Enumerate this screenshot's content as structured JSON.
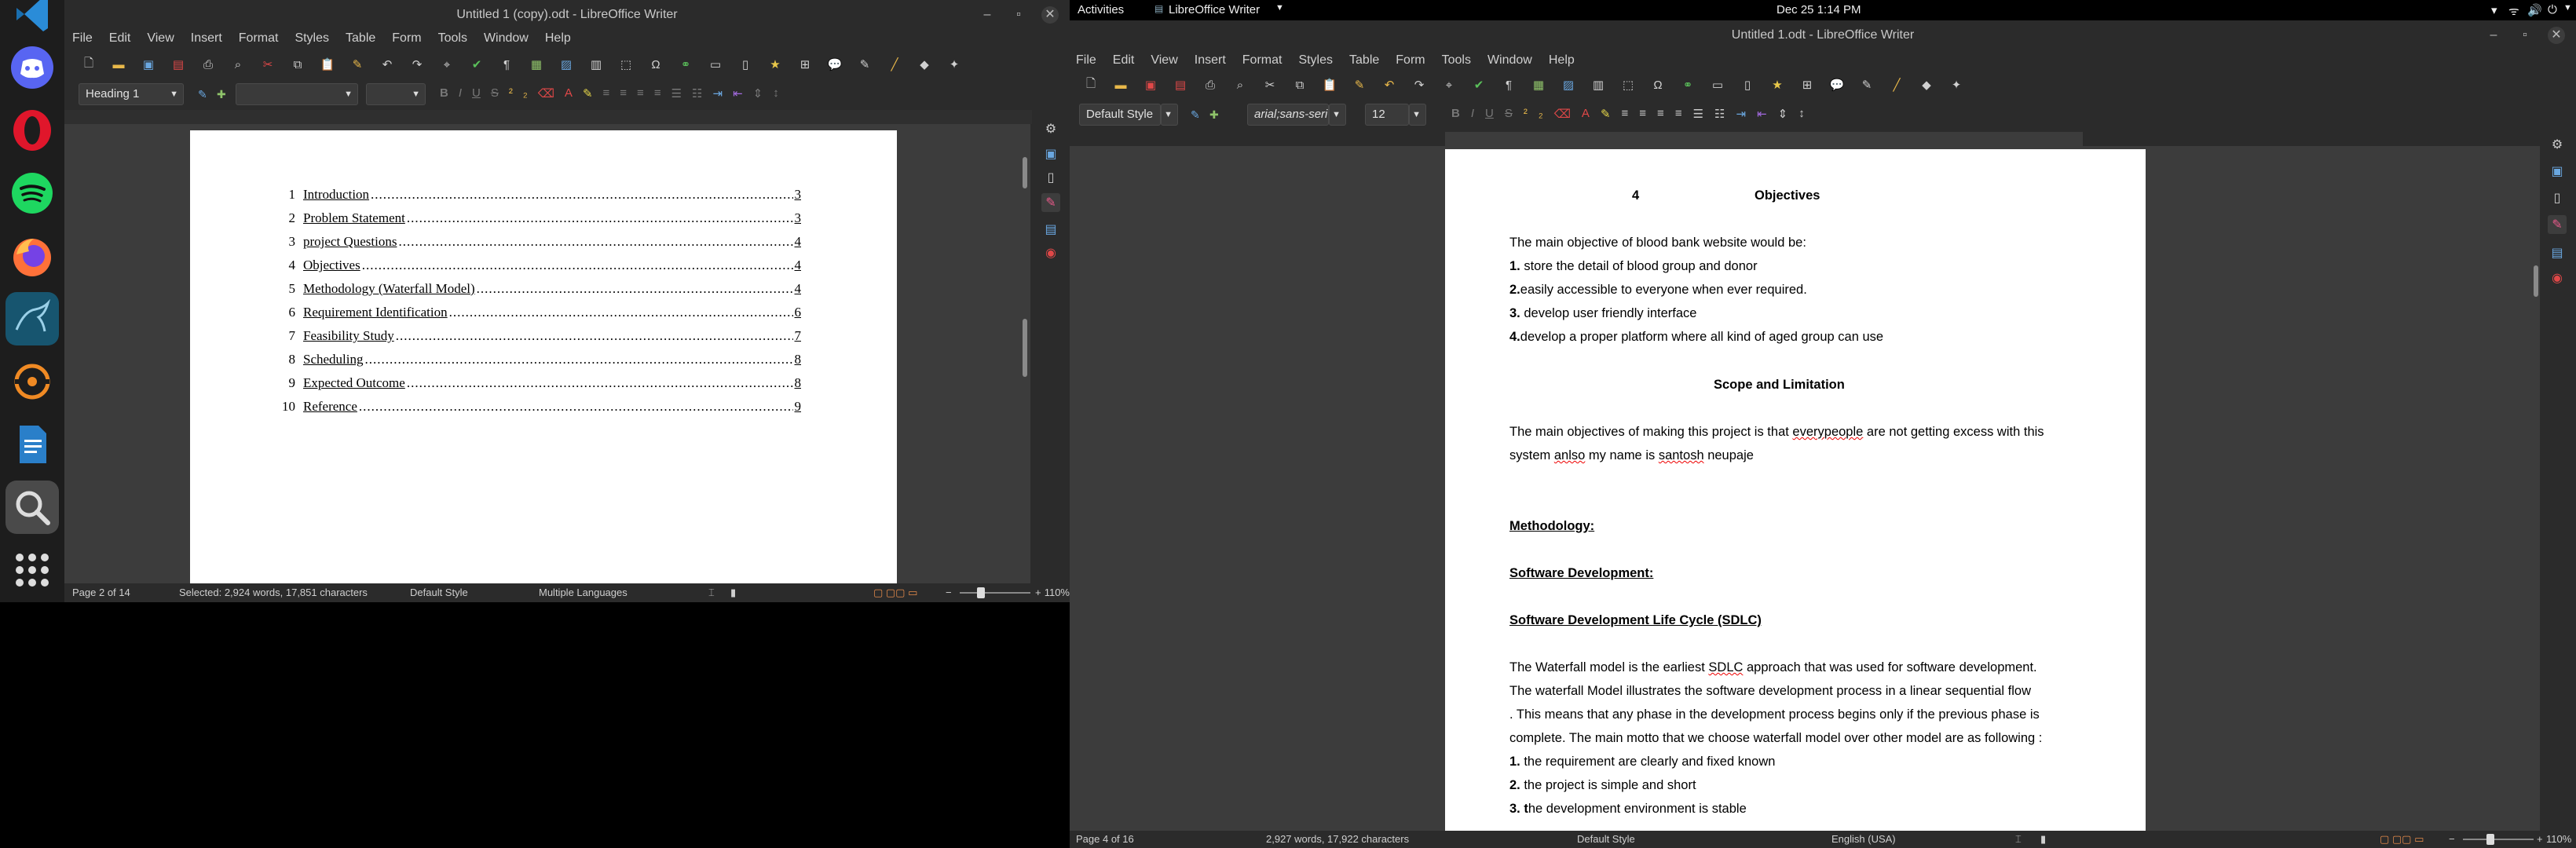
{
  "left_window": {
    "title": "Untitled 1 (copy).odt - LibreOffice Writer",
    "menu": [
      "File",
      "Edit",
      "View",
      "Insert",
      "Format",
      "Styles",
      "Table",
      "Form",
      "Tools",
      "Window",
      "Help"
    ],
    "paragraph_style": "Heading 1",
    "toc": [
      {
        "num": "1",
        "title": "Introduction",
        "page": "3"
      },
      {
        "num": "2",
        "title": "Problem Statement",
        "page": "3"
      },
      {
        "num": "3",
        "title": "project Questions",
        "page": "4"
      },
      {
        "num": "4",
        "title": "Objectives",
        "page": "4"
      },
      {
        "num": "5",
        "title": "Methodology (Waterfall Model)",
        "page": "4"
      },
      {
        "num": "6",
        "title": "Requirement Identification",
        "page": "6"
      },
      {
        "num": "7",
        "title": "Feasibility Study",
        "page": "7"
      },
      {
        "num": "8",
        "title": "Scheduling",
        "page": "8"
      },
      {
        "num": "9",
        "title": "Expected Outcome",
        "page": "8"
      },
      {
        "num": "10",
        "title": "Reference",
        "page": "9"
      }
    ],
    "status": {
      "page": "Page 2 of 14",
      "selection": "Selected: 2,924 words, 17,851 characters",
      "style": "Default Style",
      "language": "Multiple Languages",
      "zoom": "110%"
    }
  },
  "right_window": {
    "topbar": {
      "activities": "Activities",
      "app": "LibreOffice Writer",
      "clock": "Dec 25  1:14 PM"
    },
    "title": "Untitled 1.odt - LibreOffice Writer",
    "menu": [
      "File",
      "Edit",
      "View",
      "Insert",
      "Format",
      "Styles",
      "Table",
      "Form",
      "Tools",
      "Window",
      "Help"
    ],
    "paragraph_style": "Default Style",
    "font_name": "arial;sans-seri",
    "font_size": "12",
    "doc": {
      "heading_num": "4",
      "heading": "Objectives",
      "intro": "The main objective of blood bank website would be:",
      "obj1_num": "1.",
      "obj1": " store the detail of blood group and donor",
      "obj2_num": "2.",
      "obj2": "easily accessible to everyone when ever required.",
      "obj3_num": "3.",
      "obj3": " develop user friendly interface",
      "obj4_num": "4.",
      "obj4": "develop a proper platform where all kind of aged group can use",
      "scope_heading": "Scope and Limitation",
      "scope_l1_a": "The main objectives of making this project is that ",
      "scope_l1_b": "everypeople",
      "scope_l1_c": " are not getting excess with this",
      "scope_l2_a": "system ",
      "scope_l2_b": "anlso",
      "scope_l2_c": " my name is ",
      "scope_l2_d": "santosh",
      "scope_l2_e": " neupaje",
      "methodology": "Methodology:",
      "software_dev": "Software Development:",
      "sdlc": "Software Development Life Cycle (SDLC)",
      "wf1_a": "The Waterfall model is the earliest ",
      "wf1_b": "SDLC",
      "wf1_c": " approach that was used for software development.",
      "wf2": "The waterfall Model illustrates the software development process in a linear sequential flow",
      "wf3": ". This means that any phase in the development process begins only if the previous phase is",
      "wf4": "complete. The main motto that we choose waterfall model over other model are as following :",
      "m1_num": "1.",
      "m1": " the requirement are clearly and fixed known",
      "m2_num": "2.",
      "m2": " the project is simple and short",
      "m3_num": "3. t",
      "m3": "he development environment is stable"
    },
    "status": {
      "page": "Page 4 of 16",
      "words": "2,927 words, 17,922 characters",
      "style": "Default Style",
      "language": "English (USA)",
      "zoom": "110%"
    }
  },
  "colors": {
    "chrome": "#2b2b2b",
    "doc_bg": "#3c3c3c",
    "page": "#ffffff",
    "accent": "#e55a00"
  }
}
